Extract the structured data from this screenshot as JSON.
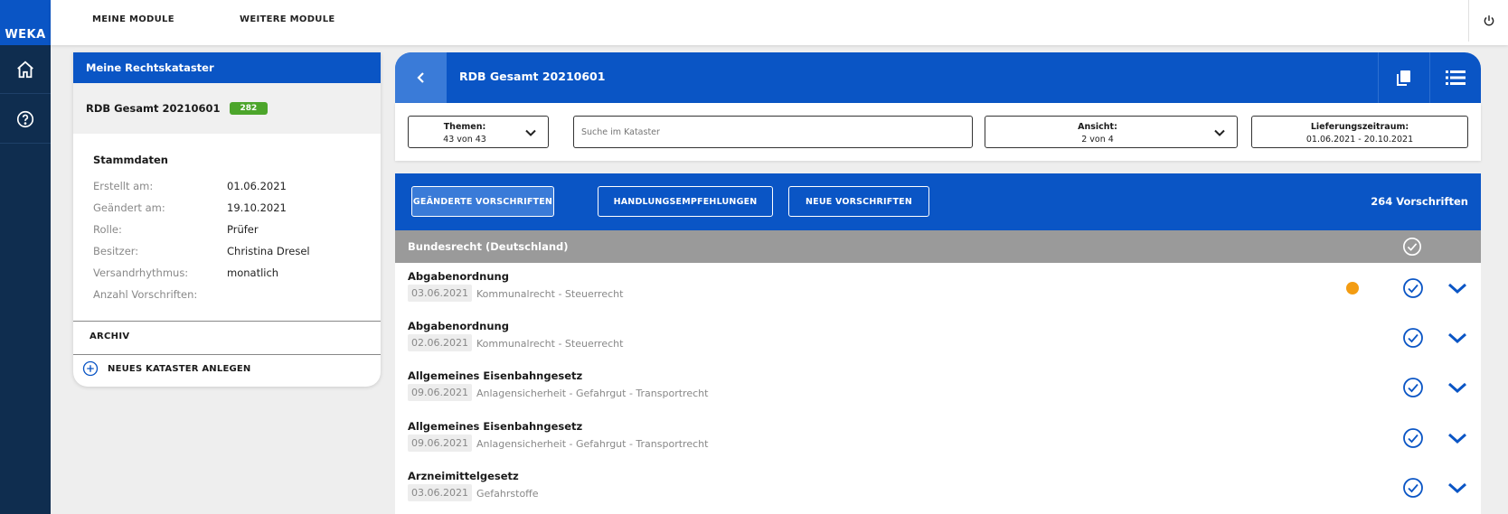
{
  "brand": {
    "logo_text": "WEKA",
    "primary": "#0a55c5",
    "rail": "#0f2d4f",
    "badge": "#4ca52b",
    "dot": "#f39c12"
  },
  "rail": {
    "items": [
      {
        "icon": "home-icon"
      },
      {
        "icon": "help-icon"
      }
    ]
  },
  "topbar": {
    "nav": [
      {
        "label": "MEINE MODULE"
      },
      {
        "label": "WEITERE MODULE"
      }
    ],
    "power_icon": "power-icon"
  },
  "sidebar": {
    "header": "Meine Rechtskataster",
    "selected": {
      "name": "RDB Gesamt 20210601",
      "badge": "282"
    },
    "stammdaten": {
      "title": "Stammdaten",
      "rows": [
        {
          "label": "Erstellt am:",
          "value": "01.06.2021"
        },
        {
          "label": "Geändert am:",
          "value": "19.10.2021"
        },
        {
          "label": "Rolle:",
          "value": "Prüfer"
        },
        {
          "label": "Besitzer:",
          "value": "Christina Dresel"
        },
        {
          "label": "Versandrhythmus:",
          "value": "monatlich"
        },
        {
          "label": "Anzahl Vorschriften:",
          "value": ""
        }
      ]
    },
    "archiv": "ARCHIV",
    "new_cadastre": "NEUES KATASTER ANLEGEN"
  },
  "main": {
    "title": "RDB Gesamt 20210601",
    "filters": {
      "themen": {
        "label": "Themen:",
        "value": "43 von 43"
      },
      "search": {
        "placeholder": "Suche im Kataster",
        "value": ""
      },
      "ansicht": {
        "label": "Ansicht:",
        "value": "2 von 4"
      },
      "lieferung": {
        "label": "Lieferungszeitraum:",
        "value": "01.06.2021 - 20.10.2021"
      }
    },
    "tabs": [
      {
        "label": "GEÄNDERTE VORSCHRIFTEN",
        "active": true
      },
      {
        "label": "HANDLUNGSEMPFEHLUNGEN",
        "active": false
      },
      {
        "label": "NEUE VORSCHRIFTEN",
        "active": false
      }
    ],
    "count": "264 Vorschriften",
    "group": {
      "title": "Bundesrecht (Deutschland)"
    },
    "items": [
      {
        "title": "Abgabenordnung",
        "date": "03.06.2021",
        "category": "Kommunalrecht - Steuerrecht",
        "has_dot": true
      },
      {
        "title": "Abgabenordnung",
        "date": "02.06.2021",
        "category": "Kommunalrecht - Steuerrecht",
        "has_dot": false
      },
      {
        "title": "Allgemeines Eisenbahngesetz",
        "date": "09.06.2021",
        "category": "Anlagensicherheit - Gefahrgut - Transportrecht",
        "has_dot": false
      },
      {
        "title": "Allgemeines Eisenbahngesetz",
        "date": "09.06.2021",
        "category": "Anlagensicherheit - Gefahrgut - Transportrecht",
        "has_dot": false
      },
      {
        "title": "Arzneimittelgesetz",
        "date": "03.06.2021",
        "category": "Gefahrstoffe",
        "has_dot": false
      }
    ]
  }
}
